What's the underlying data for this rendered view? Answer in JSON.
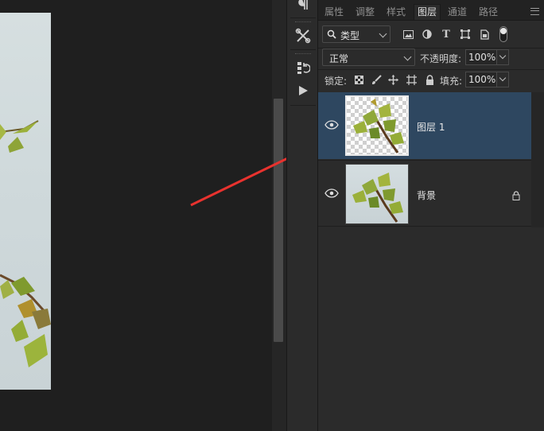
{
  "panel": {
    "tabs": [
      {
        "label": "属性"
      },
      {
        "label": "调整"
      },
      {
        "label": "样式"
      },
      {
        "label": "图层",
        "active": true
      },
      {
        "label": "通道"
      },
      {
        "label": "路径"
      }
    ],
    "filter": {
      "kind_label": "类型",
      "icons": [
        "image-filter-icon",
        "adjustment-filter-icon",
        "type-filter-icon",
        "shape-filter-icon",
        "smart-object-filter-icon",
        "filter-toggle-icon"
      ]
    },
    "blend_mode": "正常",
    "opacity": {
      "label": "不透明度:",
      "value": "100%"
    },
    "lock": {
      "label": "锁定:",
      "icons": [
        "lock-transparent-pixels-icon",
        "lock-image-pixels-icon",
        "lock-position-icon",
        "lock-artboard-icon",
        "lock-all-icon"
      ]
    },
    "fill": {
      "label": "填充:",
      "value": "100%"
    },
    "layers": [
      {
        "name": "图层 1",
        "visible": true,
        "selected": true,
        "locked": false
      },
      {
        "name": "背景",
        "visible": true,
        "selected": false,
        "locked": true
      }
    ]
  },
  "tool_strip": {
    "icons": [
      "paragraph-icon",
      "tools-icon",
      "history-icon",
      "play-action-icon"
    ]
  },
  "colors": {
    "selected_row": "#2e4760",
    "annotation_arrow": "#e8322e",
    "panel_bg": "#2b2b2b"
  }
}
